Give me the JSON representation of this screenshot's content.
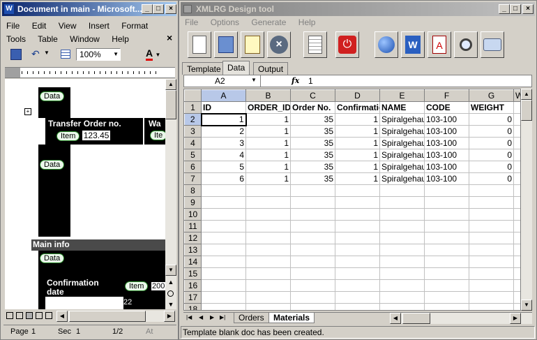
{
  "word": {
    "title": "Document in main - Microsoft...",
    "menu_row1": [
      "File",
      "Edit",
      "View",
      "Insert",
      "Format"
    ],
    "menu_row2": [
      "Tools",
      "Table",
      "Window",
      "Help"
    ],
    "close_x": "×",
    "zoom": "100%",
    "font_color_letter": "A",
    "doc": {
      "data_tag": "Data",
      "transfer_order": "Transfer Order no.",
      "item_tag": "Item",
      "item_value": "123.45",
      "wa_cut": "Wa",
      "item_cut": "Ite",
      "main_info": "Main info",
      "confirmation_date": "Confirmation date",
      "value_200": "200",
      "value_22": "22"
    },
    "status": {
      "page": "Page",
      "page_no": "1",
      "sec": "Sec",
      "sec_no": "1",
      "pages": "1/2",
      "at": "At"
    }
  },
  "xmlrg": {
    "title": "XMLRG Design tool",
    "menu": [
      "File",
      "Options",
      "Generate",
      "Help"
    ],
    "tabs": [
      "Template",
      "Data",
      "Output"
    ],
    "active_tab": "Data",
    "cell_ref": "A2",
    "fx": "fx",
    "formula_value": "1",
    "columns": [
      "A",
      "B",
      "C",
      "D",
      "E",
      "F",
      "G"
    ],
    "header_row": [
      "ID",
      "ORDER_ID",
      "Order No.",
      "Confirmation",
      "NAME",
      "CODE",
      "WEIGHT"
    ],
    "rows": [
      [
        "1",
        "1",
        "35",
        "1",
        "Spiralgehause",
        "103-100",
        "0"
      ],
      [
        "2",
        "1",
        "35",
        "1",
        "Spiralgehause",
        "103-100",
        "0"
      ],
      [
        "3",
        "1",
        "35",
        "1",
        "Spiralgehause",
        "103-100",
        "0"
      ],
      [
        "4",
        "1",
        "35",
        "1",
        "Spiralgehause",
        "103-100",
        "0"
      ],
      [
        "5",
        "1",
        "35",
        "1",
        "Spiralgehause",
        "103-100",
        "0"
      ],
      [
        "6",
        "1",
        "35",
        "1",
        "Spiralgehause",
        "103-100",
        "0"
      ]
    ],
    "row_numbers": [
      "1",
      "2",
      "3",
      "4",
      "5",
      "6",
      "7",
      "8",
      "9",
      "10",
      "11",
      "12",
      "13",
      "14",
      "15",
      "16",
      "17",
      "18"
    ],
    "sheet_tabs": [
      "Orders",
      "Materials"
    ],
    "active_sheet": "Materials",
    "status_text": "Template blank doc has been created."
  }
}
